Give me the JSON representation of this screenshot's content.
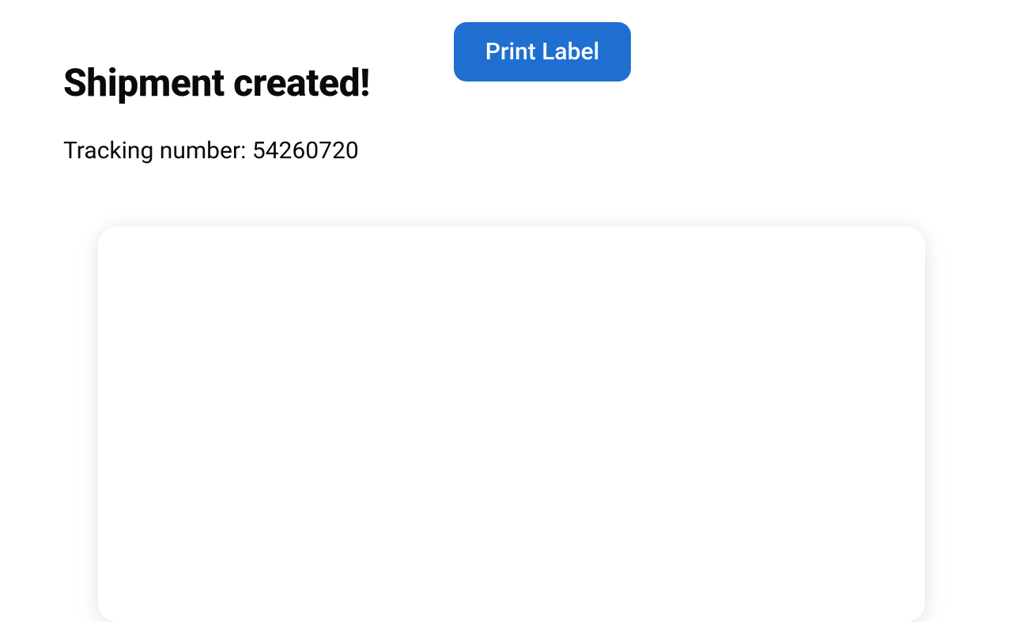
{
  "header": {
    "title": "Shipment created!",
    "print_button_label": "Print Label"
  },
  "tracking": {
    "label": "Tracking number:",
    "number": "54260720"
  }
}
